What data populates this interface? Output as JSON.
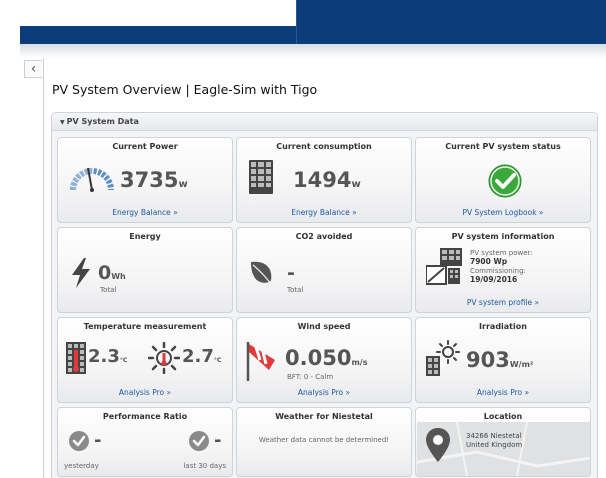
{
  "page": {
    "title": "PV System Overview | Eagle-Sim with Tigo",
    "back_glyph": "‹"
  },
  "panel": {
    "header": "PV System Data",
    "collapse_glyph": "▼"
  },
  "tiles": {
    "current_power": {
      "title": "Current Power",
      "value": "3735",
      "unit": "w",
      "link": "Energy Balance »",
      "icon": "gauge-icon"
    },
    "current_consumption": {
      "title": "Current consumption",
      "value": "1494",
      "unit": "w",
      "link": "Energy Balance »",
      "icon": "solar-panel-icon"
    },
    "pv_status": {
      "title": "Current PV system status",
      "link": "PV System Logbook »",
      "icon": "check-circle-icon",
      "status_color": "#3aa83a"
    },
    "energy": {
      "title": "Energy",
      "value": "0",
      "unit": "Wh",
      "sub": "Total",
      "icon": "lightning-icon"
    },
    "co2": {
      "title": "CO2 avoided",
      "value": "-",
      "sub": "Total",
      "icon": "leaf-icon"
    },
    "pv_info": {
      "title": "PV system information",
      "power_label": "PV system power:",
      "power_value": "7900 Wp",
      "commission_label": "Commissioning:",
      "commission_value": "19/09/2016",
      "link": "PV system profile »",
      "icon": "pv-system-icon"
    },
    "temperature": {
      "title": "Temperature measurement",
      "value1": "2.3",
      "unit1": "°C",
      "value2": "2.7",
      "unit2": "°C",
      "link": "Analysis Pro »",
      "icon1": "module-thermometer-icon",
      "icon2": "sun-thermometer-icon"
    },
    "wind": {
      "title": "Wind speed",
      "value": "0.050",
      "unit": "m/s",
      "sub": "BFT: 0 - Calm",
      "link": "Analysis Pro »",
      "icon": "windsock-icon"
    },
    "irradiation": {
      "title": "Irradiation",
      "value": "903",
      "unit": "W/m²",
      "link": "Analysis Pro »",
      "icon": "sun-panel-icon"
    },
    "performance_ratio": {
      "title": "Performance Ratio",
      "value_left": "-",
      "value_right": "-",
      "label_left": "yesterday",
      "label_right": "last 30 days",
      "icon": "check-circle-grey-icon"
    },
    "weather": {
      "title": "Weather for Niestetal",
      "message": "Weather data cannot be determined!"
    },
    "location": {
      "title": "Location",
      "line1": "34266 Niestetal",
      "line2": "United Kingdom",
      "icon": "map-pin-icon"
    }
  },
  "colors": {
    "header_blue": "#0a3d7a",
    "link_blue": "#1f57a6",
    "status_green": "#3aa83a",
    "wind_red": "#e03a3a"
  }
}
